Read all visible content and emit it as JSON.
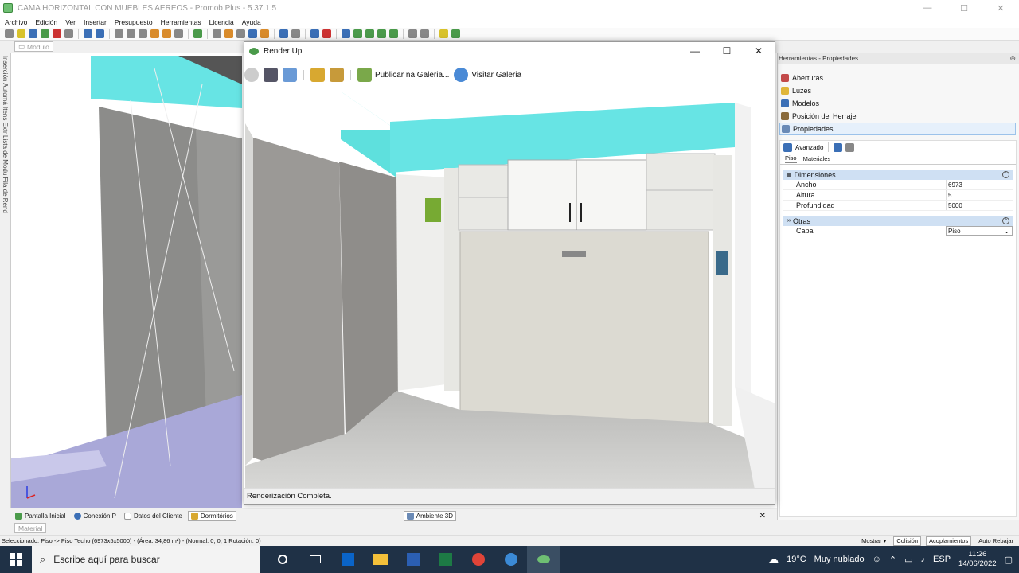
{
  "window": {
    "title": "CAMA HORIZONTAL CON MUEBLES AEREOS - Promob Plus - 5.37.1.5",
    "minimize": "—",
    "maximize": "☐",
    "close": "✕"
  },
  "menu": [
    "Archivo",
    "Edición",
    "Ver",
    "Insertar",
    "Presupuesto",
    "Herramientas",
    "Licencia",
    "Ayuda"
  ],
  "doc_tab": "Módulo",
  "left_strip_text": "Inserción Automá  Itens Extr  Lista de Modu  Fila de Rend",
  "render_window": {
    "title": "Render Up",
    "minimize": "—",
    "maximize": "☐",
    "close": "✕",
    "publish_label": "Publicar na Galeria...",
    "visit_label": "Visitar Galeria",
    "status": "Renderización Completa."
  },
  "right_panel": {
    "header": "Herramientas - Propiedades",
    "pin": "⊕",
    "items": [
      {
        "label": "Aberturas",
        "color": "#c34a4a"
      },
      {
        "label": "Luzes",
        "color": "#e0b63a"
      },
      {
        "label": "Modelos",
        "color": "#3b6fb6"
      },
      {
        "label": "Posición del Herraje",
        "color": "#8a6a3a"
      },
      {
        "label": "Propiedades",
        "color": "#6a8ab6"
      }
    ],
    "props_toolbar_label": "Avanzado",
    "tabs": [
      "Piso",
      "Materiales"
    ],
    "sections": {
      "dimensiones": {
        "title": "Dimensiones",
        "rows": [
          {
            "key": "Ancho",
            "value": "6973"
          },
          {
            "key": "Altura",
            "value": "5"
          },
          {
            "key": "Profundidad",
            "value": "5000"
          }
        ]
      },
      "otras": {
        "title": "Otras",
        "rows": [
          {
            "key": "Capa",
            "value": "Piso"
          }
        ]
      }
    }
  },
  "bottom_tabs": [
    {
      "label": "Pantalla Inicial",
      "color": "#4a9a4a"
    },
    {
      "label": "Conexión P",
      "color": "#3b6fb6"
    },
    {
      "label": "Datos del Cliente",
      "color": "#fff"
    },
    {
      "label": "Dormitórios",
      "color": "#d8a830"
    }
  ],
  "ambiente_tab": "Ambiente 3D",
  "materials_tab": "Material",
  "statusbar": {
    "text": "Seleccionado: Piso -> Piso Techo (6973x5x5000) - (Área: 34,86 m²) - (Normal: 0; 0; 1 Rotación: 0)",
    "mostrar": "Mostrar",
    "colision": "Colisión",
    "acoplamientos": "Acoplamientos",
    "auto_rebajar": "Auto Rebajar"
  },
  "taskbar": {
    "search_placeholder": "Escribe aquí para buscar",
    "weather_temp": "19°C",
    "weather_desc": "Muy nublado",
    "language": "ESP",
    "time": "11:26",
    "date": "14/06/2022"
  },
  "colors": {
    "accent_cyan": "#67e4e4",
    "floor_purple": "#a9a8d8",
    "wall_grey": "#8e8e8b",
    "taskbar": "#1f3146"
  }
}
